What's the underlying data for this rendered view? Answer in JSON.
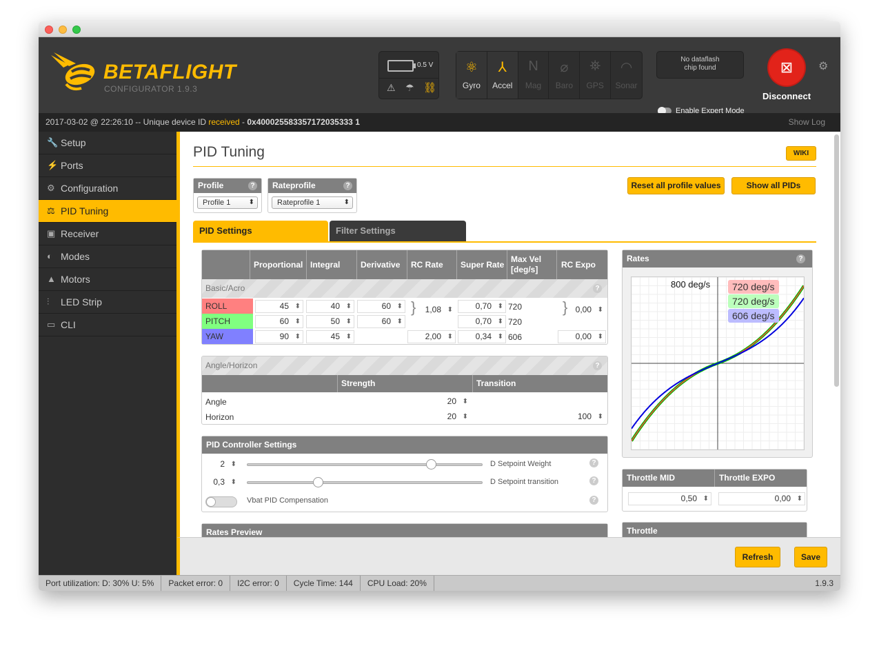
{
  "app": {
    "name": "BETAFLIGHT",
    "subtitle": "CONFIGURATOR  1.9.3"
  },
  "battery": {
    "voltage": "0.5 V"
  },
  "sensors": [
    {
      "label": "Gyro",
      "icon": "gyro-icon",
      "active": true
    },
    {
      "label": "Accel",
      "icon": "accel-icon",
      "active": true
    },
    {
      "label": "Mag",
      "icon": "mag-icon",
      "active": false
    },
    {
      "label": "Baro",
      "icon": "baro-icon",
      "active": false
    },
    {
      "label": "GPS",
      "icon": "gps-icon",
      "active": false
    },
    {
      "label": "Sonar",
      "icon": "sonar-icon",
      "active": false
    }
  ],
  "dataflash": {
    "line1": "No dataflash",
    "line2": "chip found"
  },
  "expert_mode": {
    "label": "Enable Expert Mode"
  },
  "disconnect": {
    "label": "Disconnect"
  },
  "log": {
    "prefix": "2017-03-02 @ 22:26:10 -- Unique device ID ",
    "status": "received",
    "dash": " - ",
    "device_id": "0x400025583357172035333 1",
    "show_log": "Show Log"
  },
  "nav": [
    {
      "label": "Setup",
      "icon": "wrench-icon"
    },
    {
      "label": "Ports",
      "icon": "plug-icon"
    },
    {
      "label": "Configuration",
      "icon": "gear-icon"
    },
    {
      "label": "PID Tuning",
      "icon": "pid-icon",
      "active": true
    },
    {
      "label": "Receiver",
      "icon": "receiver-icon"
    },
    {
      "label": "Modes",
      "icon": "modes-icon"
    },
    {
      "label": "Motors",
      "icon": "motor-icon"
    },
    {
      "label": "LED Strip",
      "icon": "led-icon"
    },
    {
      "label": "CLI",
      "icon": "cli-icon"
    }
  ],
  "page": {
    "title": "PID Tuning",
    "wiki": "WIKI"
  },
  "profile": {
    "label": "Profile",
    "value": "Profile 1"
  },
  "rateprofile": {
    "label": "Rateprofile",
    "value": "Rateprofile 1"
  },
  "buttons": {
    "reset": "Reset all profile values",
    "show_all": "Show all PIDs",
    "refresh": "Refresh",
    "save": "Save"
  },
  "tabs": {
    "pid": "PID Settings",
    "filter": "Filter Settings"
  },
  "pid_table": {
    "headers": [
      "Proportional",
      "Integral",
      "Derivative",
      "RC Rate",
      "Super Rate",
      "Max Vel [deg/s]",
      "RC Expo"
    ],
    "section": "Basic/Acro",
    "rows": [
      {
        "axis": "ROLL",
        "color": "#ff8080",
        "p": "45",
        "i": "40",
        "d": "60",
        "super_rate": "0,70",
        "max_vel": "720"
      },
      {
        "axis": "PITCH",
        "color": "#80ff80",
        "p": "60",
        "i": "50",
        "d": "60",
        "super_rate": "0,70",
        "max_vel": "720"
      },
      {
        "axis": "YAW",
        "color": "#8080ff",
        "p": "90",
        "i": "45",
        "d": "",
        "rc_rate": "2,00",
        "super_rate": "0,34",
        "max_vel": "606",
        "rc_expo": "0,00"
      }
    ],
    "rc_rate_rollpitch": "1,08",
    "rc_expo_rollpitch": "0,00"
  },
  "angle_horizon": {
    "title": "Angle/Horizon",
    "col_strength": "Strength",
    "col_transition": "Transition",
    "angle": {
      "label": "Angle",
      "strength": "20"
    },
    "horizon": {
      "label": "Horizon",
      "strength": "20",
      "transition": "100"
    }
  },
  "pid_controller": {
    "title": "PID Controller Settings",
    "setpoint_weight": {
      "value": "2",
      "label": "D Setpoint Weight",
      "fraction": 0.78
    },
    "setpoint_transition": {
      "value": "0,3",
      "label": "D Setpoint transition",
      "fraction": 0.3
    },
    "vbat": {
      "label": "Vbat PID Compensation"
    }
  },
  "rates_preview": {
    "title": "Rates Preview"
  },
  "rates": {
    "title": "Rates",
    "max_label": "800 deg/s",
    "roll_label": "720 deg/s",
    "pitch_label": "720 deg/s",
    "yaw_label": "606 deg/s"
  },
  "throttle": {
    "mid_label": "Throttle MID",
    "mid_value": "0,50",
    "expo_label": "Throttle EXPO",
    "expo_value": "0,00",
    "title": "Throttle"
  },
  "status": {
    "port": "Port utilization: D: 30% U: 5%",
    "packet": "Packet error: 0",
    "i2c": "I2C error: 0",
    "cycle": "Cycle Time: 144",
    "cpu": "CPU Load: 20%",
    "version": "1.9.3"
  }
}
